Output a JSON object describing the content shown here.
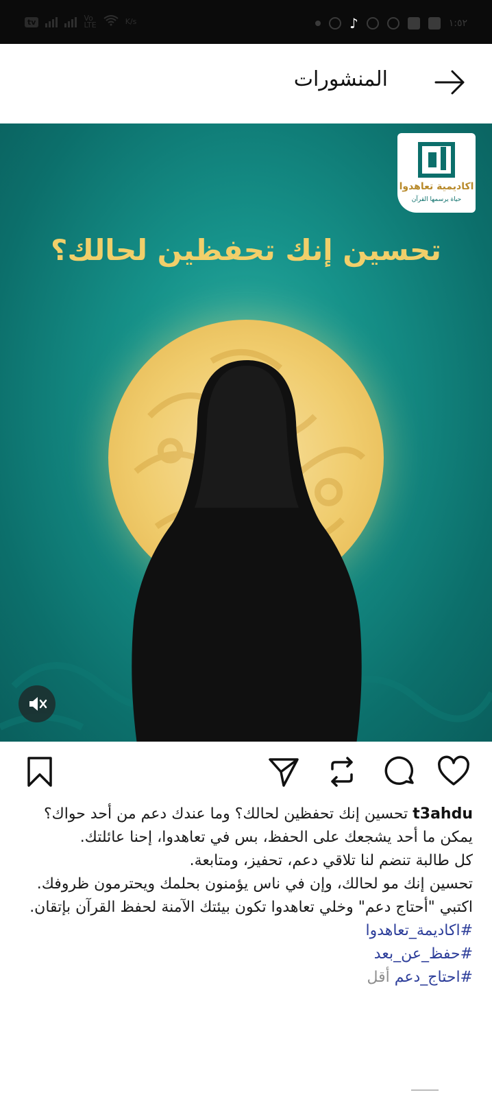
{
  "status_bar": {
    "left_texts": [
      "Vo",
      "LTE",
      "K/s"
    ],
    "right_time": "١:٥٢"
  },
  "header": {
    "title": "المنشورات"
  },
  "post": {
    "logo": {
      "name": "اكاديمية تعاهدوا",
      "tagline": "حياة يرسمها القرآن"
    },
    "headline": "تحسين إنك تحفظين لحالك؟"
  },
  "caption": {
    "username": "t3ahdu",
    "first_line": "تحسين إنك تحفظين لحالك؟ وما عندك دعم من أحد حواك؟",
    "lines": [
      "يمكن ما أحد يشجعك على الحفظ، بس في تعاهدوا، إحنا عائلتك.",
      "كل طالبة تنضم لنا تلاقي دعم، تحفيز، ومتابعة.",
      "تحسين إنك مو لحالك، وإن في ناس يؤمنون بحلمك ويحترمون ظروفك.",
      "اكتبي \"أحتاج دعم\" وخلي تعاهدوا تكون بيئتك الآمنة لحفظ القرآن بإتقان."
    ],
    "hashtags": [
      "#اكاديمة_تعاهدوا",
      "#حفظ_عن_بعد",
      "#احتاج_دعم"
    ],
    "less_label": "أقل"
  },
  "colors": {
    "teal": "#0c6f6b",
    "gold": "#f1cf6a",
    "hashtag": "#2d3e9a"
  },
  "icons": {
    "header": "arrow-right-icon",
    "actions": [
      "heart-icon",
      "comment-icon",
      "repost-icon",
      "send-icon",
      "bookmark-icon"
    ],
    "mute": "mute-icon"
  }
}
